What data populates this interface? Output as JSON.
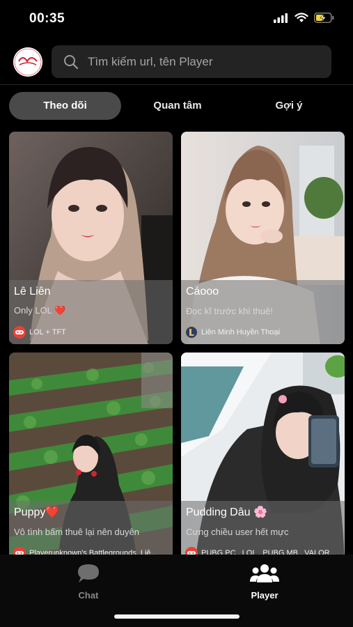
{
  "status_bar": {
    "time": "00:35"
  },
  "header": {
    "avatar_logo_text": "Mona fancy",
    "search_placeholder": "Tìm kiếm url, tên Player"
  },
  "tabs": [
    {
      "label": "Theo dõi",
      "active": true
    },
    {
      "label": "Quan tâm",
      "active": false
    },
    {
      "label": "Gợi ý",
      "active": false
    }
  ],
  "cards": [
    {
      "name": "Lê Liên",
      "status": "Only LOL ❤️",
      "games": "LOL + TFT",
      "game_icon": "game-controller-icon",
      "icon_color": "#e8413a"
    },
    {
      "name": "Cáooo",
      "status": "Đọc kĩ trước khi thuê!",
      "games": "Liên Minh Huyền Thoại",
      "game_icon": "lol-crest-icon",
      "icon_color": "#2a3e6b"
    },
    {
      "name": "Puppy❤️",
      "status": "Vô tình bấm thuê lại nên duyên",
      "games": "Playerunknown's Battlegrounds, Liê...",
      "game_icon": "game-controller-icon",
      "icon_color": "#e8413a"
    },
    {
      "name": "Pudding Dâu 🌸",
      "status": "Cưng chiều user hết mực",
      "games": "PUBG PC , LOL , PUBG MB , VALOR...",
      "game_icon": "game-controller-icon",
      "icon_color": "#e8413a"
    }
  ],
  "bottom_nav": [
    {
      "label": "Chat",
      "icon": "chat-bubble-icon",
      "active": false
    },
    {
      "label": "Player",
      "icon": "users-icon",
      "active": true
    }
  ]
}
